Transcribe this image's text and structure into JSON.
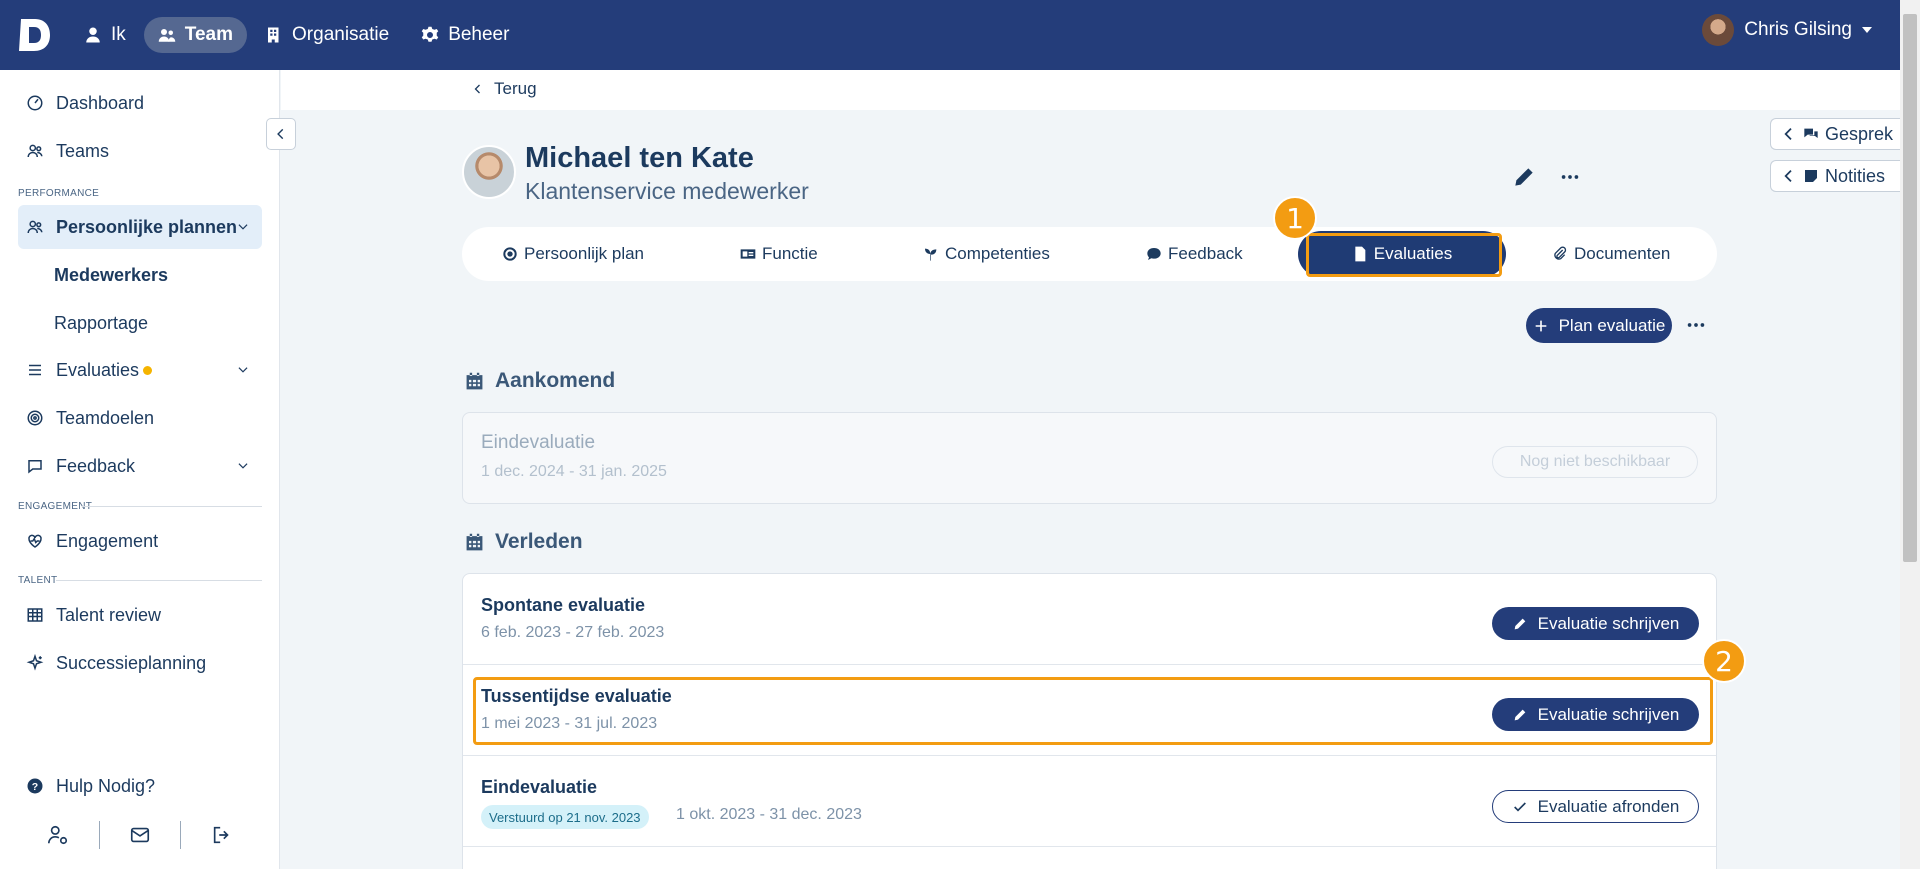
{
  "topnav": {
    "items": [
      {
        "label": "Ik",
        "icon": "user-icon"
      },
      {
        "label": "Team",
        "icon": "users-icon"
      },
      {
        "label": "Organisatie",
        "icon": "building-icon"
      },
      {
        "label": "Beheer",
        "icon": "gear-icon"
      }
    ],
    "user_name": "Chris Gilsing"
  },
  "sidebar": {
    "dashboard": "Dashboard",
    "teams": "Teams",
    "section_performance": "PERFORMANCE",
    "persoonlijke_plannen": "Persoonlijke plannen",
    "medewerkers": "Medewerkers",
    "rapportage": "Rapportage",
    "evaluaties": "Evaluaties",
    "teamdoelen": "Teamdoelen",
    "feedback": "Feedback",
    "section_engagement": "ENGAGEMENT",
    "engagement": "Engagement",
    "section_talent": "TALENT",
    "talent_review": "Talent review",
    "successieplanning": "Successieplanning",
    "help": "Hulp Nodig?"
  },
  "main": {
    "back": "Terug",
    "person_name": "Michael ten Kate",
    "person_role": "Klantenservice medewerker",
    "tabs": [
      {
        "label": "Persoonlijk plan",
        "icon": "target-icon"
      },
      {
        "label": "Functie",
        "icon": "id-card-icon"
      },
      {
        "label": "Competenties",
        "icon": "seedling-icon"
      },
      {
        "label": "Feedback",
        "icon": "comment-icon"
      },
      {
        "label": "Evaluaties",
        "icon": "file-icon"
      },
      {
        "label": "Documenten",
        "icon": "paperclip-icon"
      }
    ],
    "plan_button": "Plan evaluatie",
    "upcoming_title": "Aankomend",
    "upcoming": {
      "title": "Eindevaluatie",
      "date": "1 dec. 2024 - 31 jan. 2025",
      "status": "Nog niet beschikbaar"
    },
    "past_title": "Verleden",
    "past": [
      {
        "title": "Spontane evaluatie",
        "date": "6 feb. 2023 - 27 feb. 2023",
        "action": "Evaluatie schrijven"
      },
      {
        "title": "Tussentijdse evaluatie",
        "date": "1 mei 2023 - 31 jul. 2023",
        "action": "Evaluatie schrijven"
      },
      {
        "title": "Eindevaluatie",
        "badge": "Verstuurd op 21 nov. 2023",
        "date": "1 okt. 2023 - 31 dec. 2023",
        "action": "Evaluatie afronden"
      }
    ]
  },
  "right_panel": {
    "gesprek": "Gesprek",
    "notities": "Notities"
  },
  "markers": [
    "1",
    "2"
  ],
  "colors": {
    "topbar": "#243d7a",
    "primary": "#243d7a",
    "highlight": "#f39c12",
    "accent_dot": "#f5b400"
  }
}
